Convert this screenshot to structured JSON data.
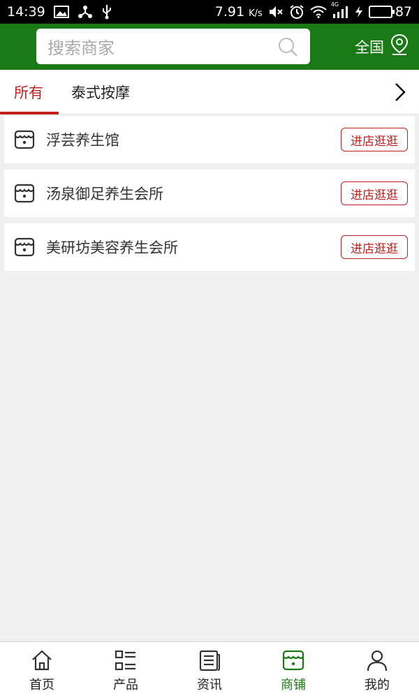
{
  "status_bar": {
    "time": "14:39",
    "net_speed": "7.91",
    "net_unit": "K/s",
    "network_type": "4G",
    "battery": "87",
    "battery_level": 0.87
  },
  "header": {
    "search_placeholder": "搜索商家",
    "region_label": "全国"
  },
  "tabs": [
    {
      "label": "所有",
      "active": true
    },
    {
      "label": "泰式按摩",
      "active": false
    }
  ],
  "shops": [
    {
      "name": "浮芸养生馆",
      "action": "进店逛逛"
    },
    {
      "name": "汤泉御足养生会所",
      "action": "进店逛逛"
    },
    {
      "name": "美研坊美容养生会所",
      "action": "进店逛逛"
    }
  ],
  "bottom_nav": [
    {
      "label": "首页",
      "icon": "home-icon",
      "active": false
    },
    {
      "label": "产品",
      "icon": "grid-list-icon",
      "active": false
    },
    {
      "label": "资讯",
      "icon": "news-icon",
      "active": false
    },
    {
      "label": "商铺",
      "icon": "shop-icon",
      "active": true
    },
    {
      "label": "我的",
      "icon": "user-icon",
      "active": false
    }
  ],
  "colors": {
    "header_green": "#1a7a16",
    "accent_red": "#c0201e",
    "background": "#f0f0f0"
  }
}
